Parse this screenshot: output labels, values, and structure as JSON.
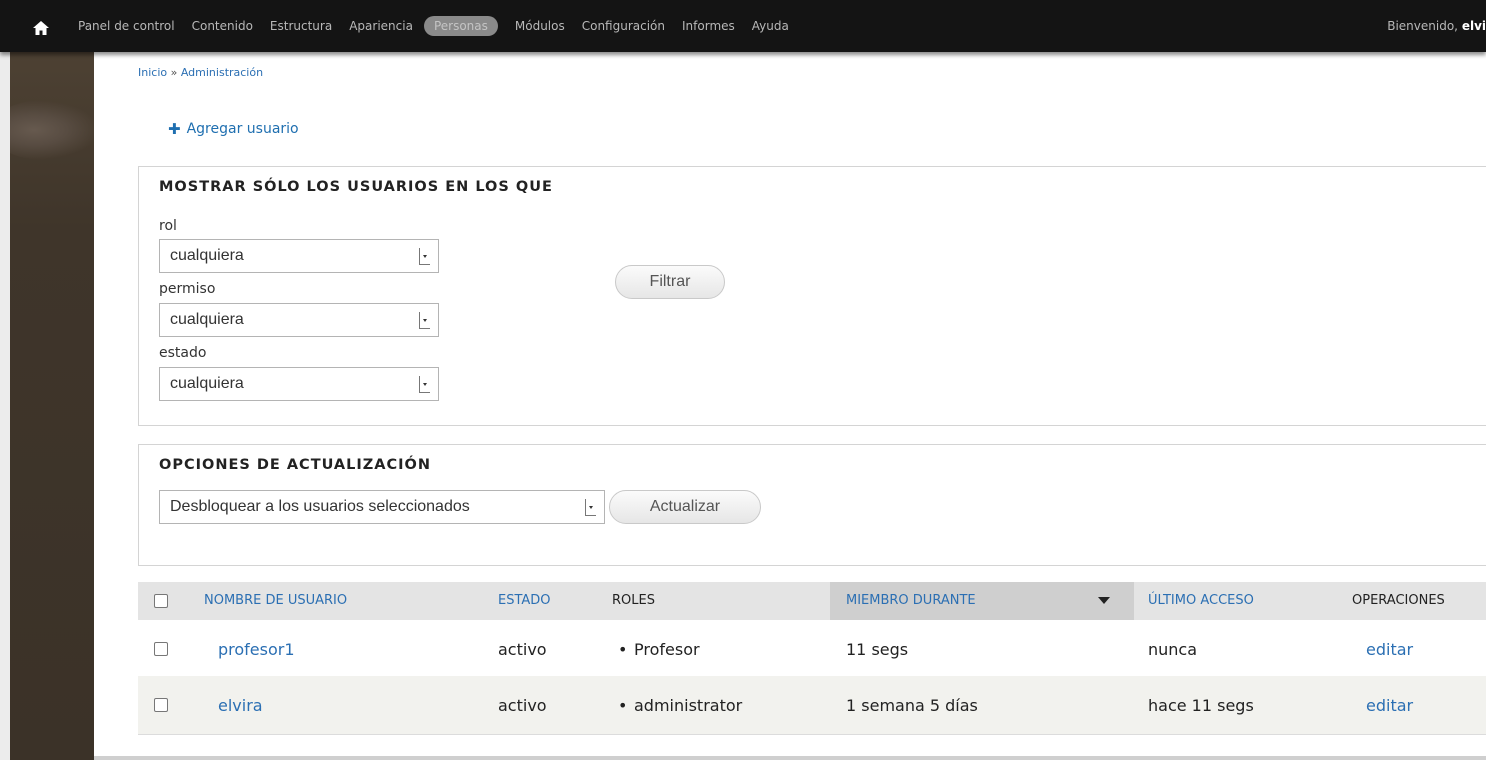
{
  "toolbar": {
    "menu": [
      "Panel de control",
      "Contenido",
      "Estructura",
      "Apariencia",
      "Personas",
      "Módulos",
      "Configuración",
      "Informes",
      "Ayuda"
    ],
    "active_item": "Personas",
    "welcome_prefix": "Bienvenido,",
    "welcome_user": "elvi"
  },
  "breadcrumb": {
    "home": "Inicio",
    "separator": "»",
    "current": "Administración"
  },
  "add_user": {
    "icon": "plus-icon",
    "label": "Agregar usuario"
  },
  "filter": {
    "legend": "MOSTRAR SÓLO LOS USUARIOS EN LOS QUE",
    "fields": [
      {
        "label": "rol",
        "value": "cualquiera"
      },
      {
        "label": "permiso",
        "value": "cualquiera"
      },
      {
        "label": "estado",
        "value": "cualquiera"
      }
    ],
    "button": "Filtrar"
  },
  "update": {
    "legend": "OPCIONES DE ACTUALIZACIÓN",
    "select_value": "Desbloquear a los usuarios seleccionados",
    "button": "Actualizar"
  },
  "table": {
    "headers": [
      "NOMBRE DE USUARIO",
      "ESTADO",
      "ROLES",
      "MIEMBRO DURANTE",
      "ÚLTIMO ACCESO",
      "OPERACIONES"
    ],
    "sorted_column": "MIEMBRO DURANTE",
    "rows": [
      {
        "username": "profesor1",
        "status": "activo",
        "role": "Profesor",
        "member_for": "11 segs",
        "last_access": "nunca",
        "operation": "editar"
      },
      {
        "username": "elvira",
        "status": "activo",
        "role": "administrator",
        "member_for": "1 semana 5 días",
        "last_access": "hace 11 segs",
        "operation": "editar"
      }
    ]
  },
  "colors": {
    "toolbar": "#141414",
    "link": "#2b6fb3",
    "header_row": "#e4e4e4",
    "alt_row": "#f2f2ee"
  }
}
